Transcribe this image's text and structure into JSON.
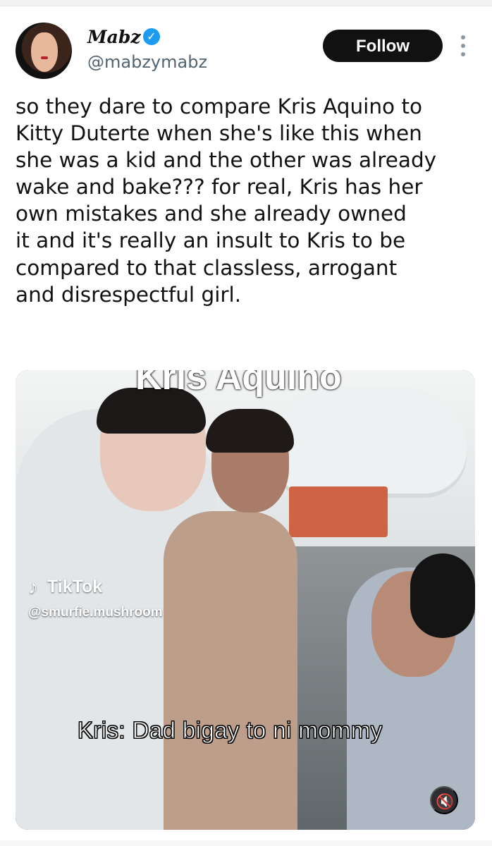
{
  "user": {
    "display_name": "Mabz",
    "handle": "@mabzymabz",
    "verified_badge": "✓"
  },
  "actions": {
    "follow_label": "Follow"
  },
  "post": {
    "text": "so they dare to compare Kris Aquino to\nKitty Duterte when she's like this when\nshe was a kid and the other was already\nwake and bake??? for real, Kris has her\nown mistakes and she already owned\nit and it's really an insult to Kris to be\ncompared to that classless, arrogant\nand disrespectful girl."
  },
  "media": {
    "overlay_title": "Kris Aquino",
    "watermark_brand": "TikTok",
    "watermark_user": "@smurfie.mushroom",
    "subtitle": "Kris: Dad bigay to ni mommy",
    "mute_icon": "🔇"
  },
  "icons": {
    "more": "more-vertical-icon",
    "mute": "speaker-muted-icon",
    "verified": "verified-badge-icon"
  },
  "colors": {
    "follow_bg": "#111111",
    "verified": "#1d9bf0",
    "handle": "#536471"
  }
}
